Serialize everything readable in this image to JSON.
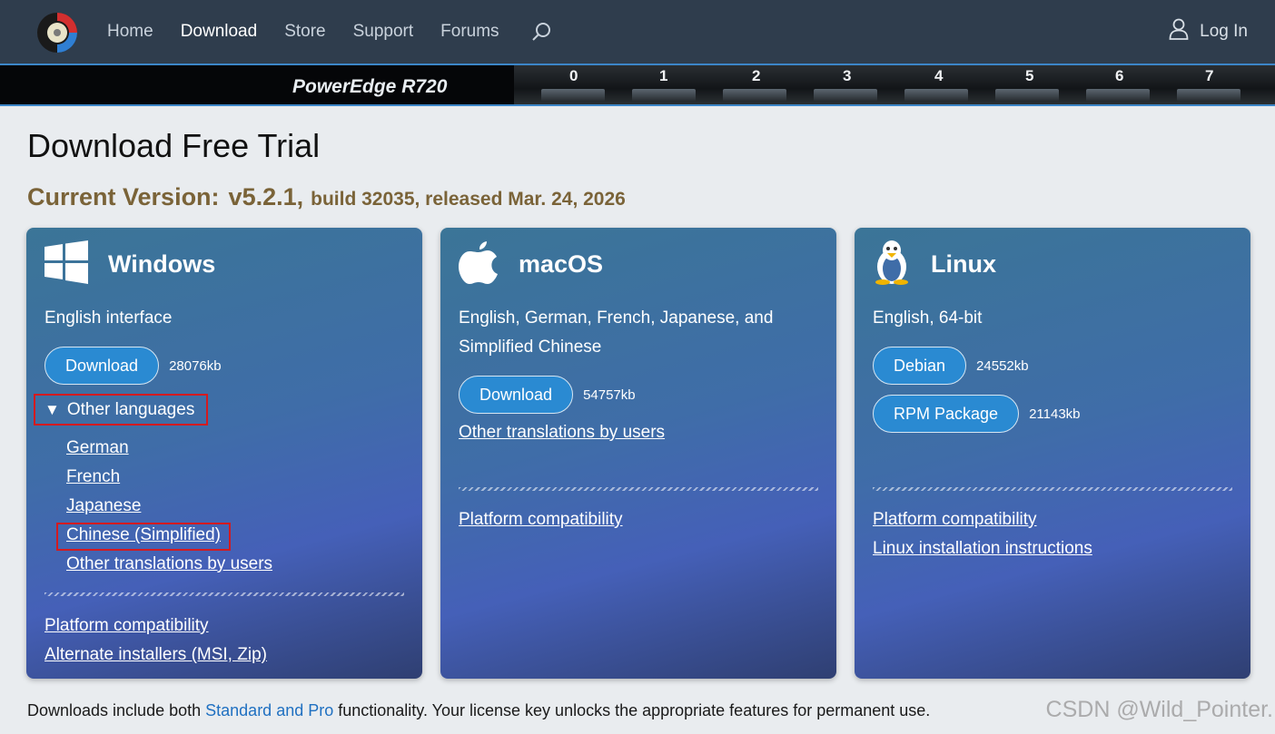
{
  "nav": {
    "items": [
      {
        "label": "Home"
      },
      {
        "label": "Download"
      },
      {
        "label": "Store"
      },
      {
        "label": "Support"
      },
      {
        "label": "Forums"
      }
    ],
    "login_label": "Log In"
  },
  "banner": {
    "model": "PowerEdge R720",
    "bays": [
      "0",
      "1",
      "2",
      "3",
      "4",
      "5",
      "6",
      "7"
    ]
  },
  "page": {
    "title": "Download Free Trial",
    "version_label": "Current Version:",
    "version_number": "v5.2.1,",
    "version_build": "build 32035, released Mar. 24, 2026"
  },
  "windows": {
    "title": "Windows",
    "desc": "English interface",
    "download_label": "Download",
    "download_size": "28076kb",
    "other_languages": "Other languages",
    "languages": [
      "German",
      "French",
      "Japanese",
      "Chinese (Simplified)",
      "Other translations by users"
    ],
    "platform_link": "Platform compatibility",
    "alt_installers": "Alternate installers (MSI, Zip)"
  },
  "macos": {
    "title": "macOS",
    "desc": "English, German, French, Japanese, and Simplified Chinese",
    "download_label": "Download",
    "download_size": "54757kb",
    "other_translations": "Other translations by users",
    "platform_link": "Platform compatibility"
  },
  "linux": {
    "title": "Linux",
    "desc": "English, 64-bit",
    "debian_label": "Debian",
    "debian_size": "24552kb",
    "rpm_label": "RPM Package",
    "rpm_size": "21143kb",
    "platform_link": "Platform compatibility",
    "install_link": "Linux installation instructions"
  },
  "footer": {
    "prefix": "Downloads include both ",
    "link": "Standard and Pro",
    "suffix": " functionality.  Your license key unlocks the appropriate features for permanent use."
  },
  "watermark": "CSDN @Wild_Pointer."
}
